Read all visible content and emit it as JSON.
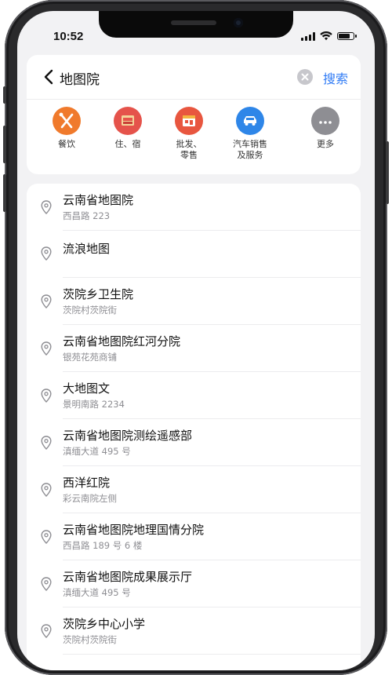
{
  "status_bar": {
    "time": "10:52",
    "battery_level": 0.85
  },
  "search": {
    "query": "地图院",
    "button_label": "搜索"
  },
  "colors": {
    "accent": "#2f7bf5",
    "food": "#f07a2c",
    "hotel": "#e5534b",
    "wholesale": "#e8563f",
    "auto": "#2e86e8",
    "more": "#8e8e93"
  },
  "categories": [
    {
      "label": "餐饮",
      "icon": "fork-knife-icon"
    },
    {
      "label": "住、宿",
      "icon": "bed-icon"
    },
    {
      "label": "批发、\n零售",
      "icon": "storefront-icon"
    },
    {
      "label": "汽车销售\n及服务",
      "icon": "car-icon"
    },
    {
      "label": "更多",
      "icon": "more-dots-icon"
    }
  ],
  "results": [
    {
      "title": "云南省地图院",
      "subtitle": "西昌路 223"
    },
    {
      "title": "流浪地图",
      "subtitle": ""
    },
    {
      "title": "茨院乡卫生院",
      "subtitle": "茨院村茨院街"
    },
    {
      "title": "云南省地图院红河分院",
      "subtitle": "银苑花苑商铺"
    },
    {
      "title": "大地图文",
      "subtitle": "景明南路 2234"
    },
    {
      "title": "云南省地图院测绘遥感部",
      "subtitle": "滇缅大道 495 号"
    },
    {
      "title": "西洋红院",
      "subtitle": "彩云南院左侧"
    },
    {
      "title": "云南省地图院地理国情分院",
      "subtitle": "西昌路 189 号 6 楼"
    },
    {
      "title": "云南省地图院成果展示厅",
      "subtitle": "滇缅大道 495 号"
    },
    {
      "title": "茨院乡中心小学",
      "subtitle": "茨院村茨院街"
    }
  ]
}
